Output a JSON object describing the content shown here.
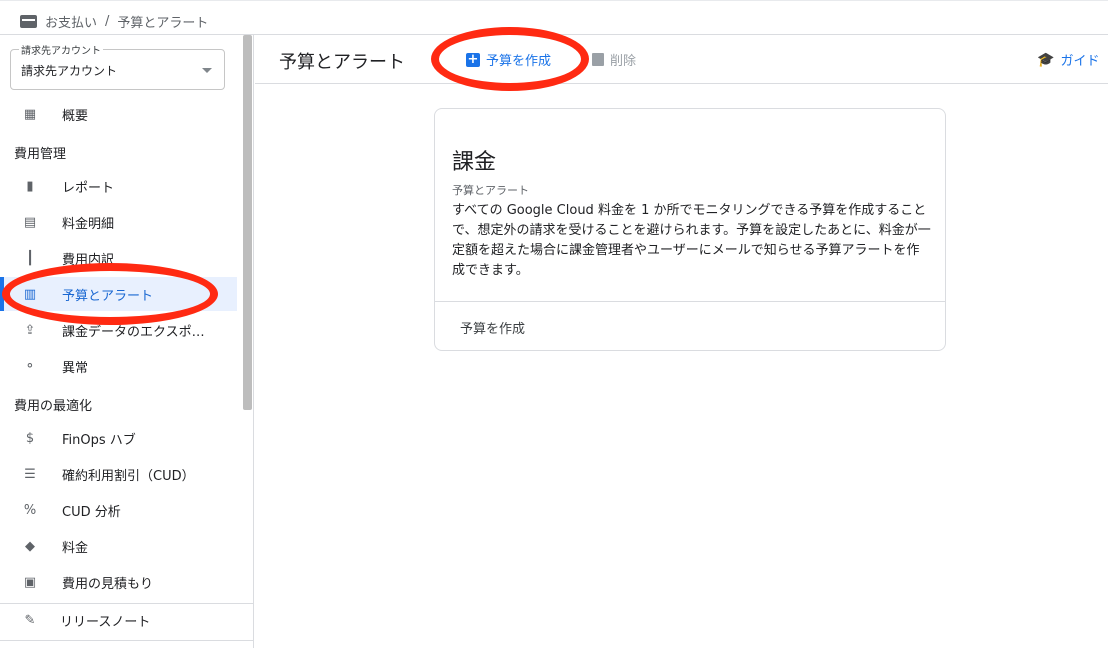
{
  "breadcrumb": {
    "root": "お支払い",
    "sep": "/",
    "current": "予算とアラート"
  },
  "account": {
    "label": "請求先アカウント",
    "value": "請求先アカウント"
  },
  "nav": {
    "overview": "概要",
    "section_cost": "費用管理",
    "reports": "レポート",
    "cost_table": "料金明細",
    "breakdown": "費用内訳",
    "budgets": "予算とアラート",
    "export": "課金データのエクスポ…",
    "anomalies": "異常",
    "section_opt": "費用の最適化",
    "finops": "FinOps ハブ",
    "cud": "確約利用割引（CUD）",
    "cud_analysis": "CUD 分析",
    "pricing": "料金",
    "estimate": "費用の見積もり",
    "release_notes": "リリースノート"
  },
  "toolbar": {
    "title": "予算とアラート",
    "create": "予算を作成",
    "delete": "削除",
    "guide": "ガイド"
  },
  "card": {
    "title": "課金",
    "subtitle": "予算とアラート",
    "body": "すべての Google Cloud 料金を 1 か所でモニタリングできる予算を作成することで、想定外の請求を受けることを避けられます。予算を設定したあとに、料金が一定額を超えた場合に課金管理者やユーザーにメールで知らせる予算アラートを作成できます。",
    "action": "予算を作成"
  },
  "colors": {
    "accent": "#1a73e8",
    "highlight_ring": "#ff2a12",
    "active_bg": "#e8f0fe"
  }
}
